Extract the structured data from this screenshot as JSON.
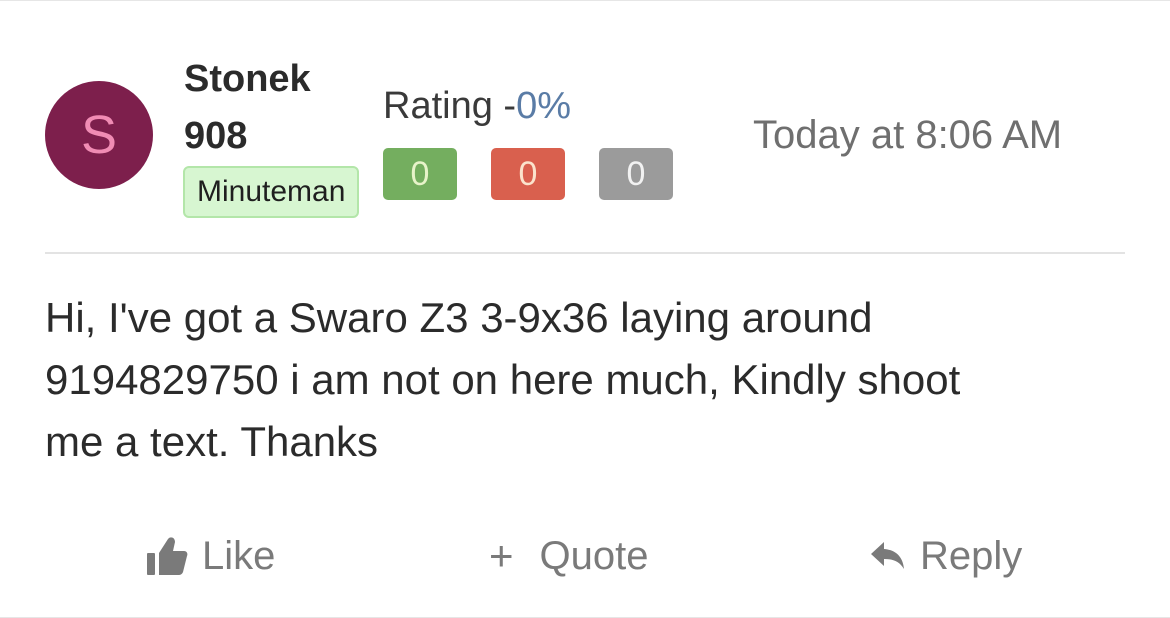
{
  "post": {
    "author": {
      "avatar_letter": "S",
      "avatar_color": "#7d1f4c",
      "name_line1": "Stonek",
      "name_line2": "908",
      "title": "Minuteman"
    },
    "rating": {
      "label": "Rating -",
      "percent": "0%",
      "positive": "0",
      "negative": "0",
      "neutral": "0"
    },
    "timestamp": "Today at 8:06 AM",
    "message_lines": [
      "Hi, I've got a Swaro Z3 3-9x36 laying around",
      "9194829750 i am not on here much, Kindly shoot",
      "me a text. Thanks"
    ],
    "actions": {
      "like_label": "Like",
      "like_icon": "thumbs-up-icon",
      "quote_label": "Quote",
      "quote_icon": "plus-icon",
      "reply_label": "Reply",
      "reply_icon": "reply-arrow-icon"
    },
    "colors": {
      "positive": "#74ae5f",
      "negative": "#d9604e",
      "neutral": "#9b9b9b",
      "title_badge": "#d7f6d1"
    }
  }
}
